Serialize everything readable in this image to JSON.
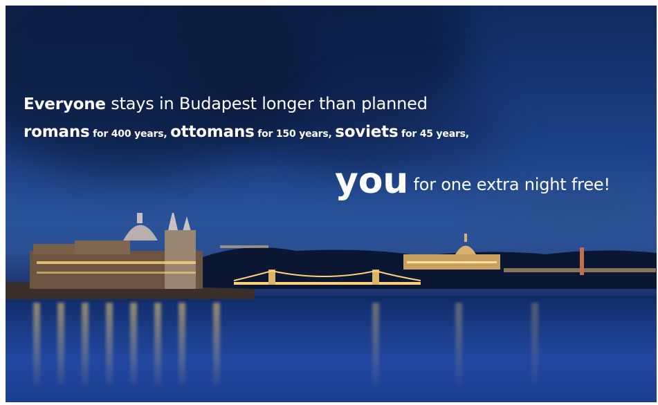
{
  "headline": {
    "line1_bold": "Everyone",
    "line1_rest": "stays in Budapest longer than planned",
    "line2": [
      {
        "bold": "romans",
        "small": "for 400 years,"
      },
      {
        "bold": "ottomans",
        "small": "for 150 years,"
      },
      {
        "bold": "soviets",
        "small": "for 45 years,"
      }
    ],
    "line3_bold": "you",
    "line3_rest": "for one extra night free!"
  },
  "colors": {
    "text": "#ffffff",
    "sky": "#1b3f86",
    "lights": "#ffd27a"
  },
  "icons": {
    "parliament": "parliament-building-icon",
    "bridge": "chain-bridge-icon",
    "castle": "buda-castle-icon"
  }
}
